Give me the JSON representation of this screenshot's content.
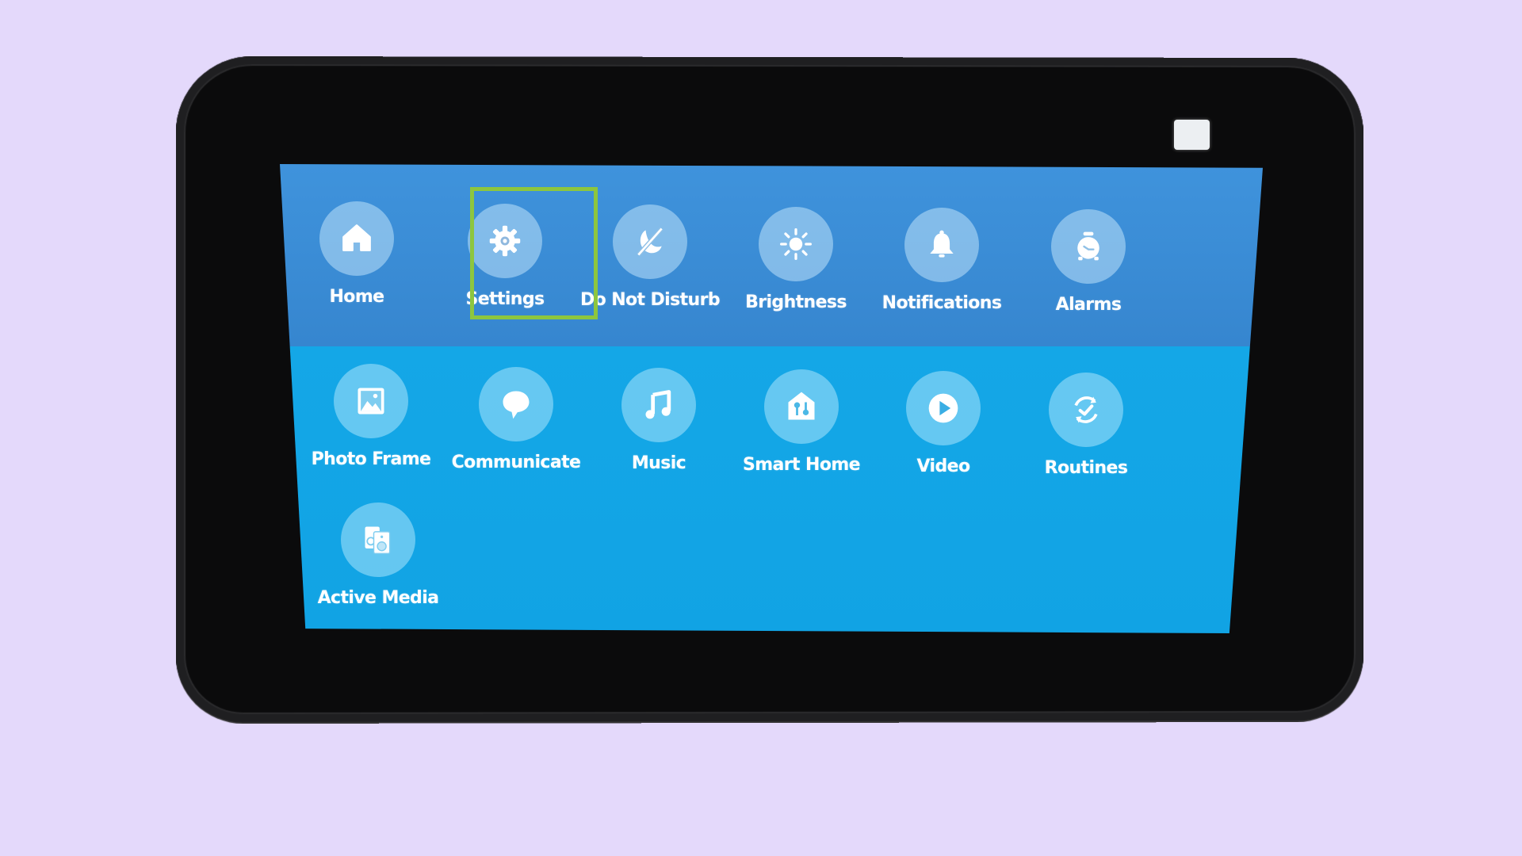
{
  "background_color": "#E4D9FB",
  "highlight_color": "#8DC63F",
  "highlighted_item": "Settings",
  "quick_settings": [
    {
      "label": "Home",
      "icon": "home-icon"
    },
    {
      "label": "Settings",
      "icon": "gear-icon"
    },
    {
      "label": "Do Not Disturb",
      "icon": "moon-slash-icon"
    },
    {
      "label": "Brightness",
      "icon": "sun-icon"
    },
    {
      "label": "Notifications",
      "icon": "bell-icon"
    },
    {
      "label": "Alarms",
      "icon": "alarm-clock-icon"
    }
  ],
  "apps": [
    {
      "label": "Photo Frame",
      "icon": "picture-icon"
    },
    {
      "label": "Communicate",
      "icon": "speech-bubble-icon"
    },
    {
      "label": "Music",
      "icon": "music-note-icon"
    },
    {
      "label": "Smart Home",
      "icon": "smart-home-icon"
    },
    {
      "label": "Video",
      "icon": "play-icon"
    },
    {
      "label": "Routines",
      "icon": "routine-check-icon"
    },
    {
      "label": "Active Media",
      "icon": "speakers-icon"
    }
  ]
}
